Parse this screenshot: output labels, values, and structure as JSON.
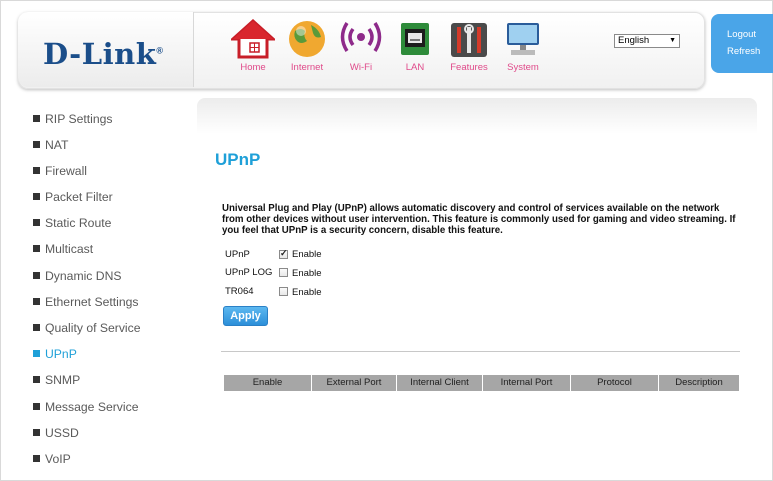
{
  "brand": {
    "logo_text": "D-Link",
    "logo_mark": "®"
  },
  "nav": [
    {
      "label": "Home",
      "icon": "home-icon"
    },
    {
      "label": "Internet",
      "icon": "globe-icon"
    },
    {
      "label": "Wi-Fi",
      "icon": "wifi-icon"
    },
    {
      "label": "LAN",
      "icon": "lan-port-icon"
    },
    {
      "label": "Features",
      "icon": "tools-icon"
    },
    {
      "label": "System",
      "icon": "monitor-icon"
    }
  ],
  "language": {
    "selected": "English"
  },
  "account": {
    "logout": "Logout",
    "refresh": "Refresh"
  },
  "sidebar": {
    "items": [
      {
        "label": "RIP Settings"
      },
      {
        "label": "NAT"
      },
      {
        "label": "Firewall"
      },
      {
        "label": "Packet Filter"
      },
      {
        "label": "Static Route"
      },
      {
        "label": "Multicast"
      },
      {
        "label": "Dynamic DNS"
      },
      {
        "label": "Ethernet Settings"
      },
      {
        "label": "Quality of Service"
      },
      {
        "label": "UPnP",
        "active": true
      },
      {
        "label": "SNMP"
      },
      {
        "label": "Message Service"
      },
      {
        "label": "USSD"
      },
      {
        "label": "VoIP"
      }
    ]
  },
  "main": {
    "title": "UPnP",
    "description_lines": [
      "Universal Plug and Play (UPnP) allows automatic discovery and control of services available on the network",
      "from other devices without user intervention. This feature is commonly used for gaming and video streaming. If",
      "you feel that UPnP is a security concern, disable this feature."
    ],
    "options": [
      {
        "label": "UPnP",
        "text": "Enable",
        "checked": true
      },
      {
        "label": "UPnP LOG",
        "text": "Enable",
        "checked": false
      },
      {
        "label": "TR064",
        "text": "Enable",
        "checked": false
      }
    ],
    "apply_label": "Apply",
    "table_headers": [
      "Enable",
      "External Port",
      "Internal Client",
      "Internal Port",
      "Protocol",
      "Description"
    ]
  },
  "colors": {
    "accent": "#1fa0d8",
    "nav_label": "#e04a8a",
    "brand": "#1b4e8a",
    "account_bg": "#4aa5e8"
  }
}
